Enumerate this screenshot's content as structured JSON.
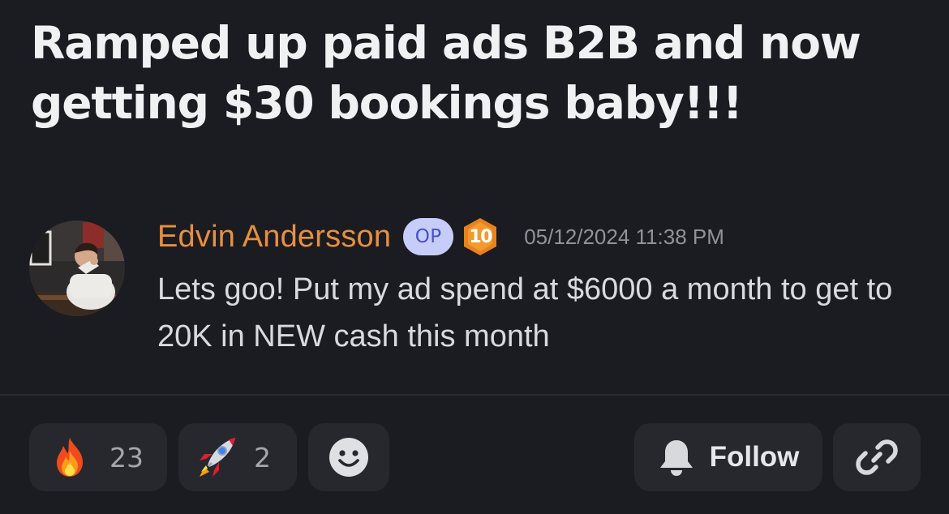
{
  "post": {
    "title": "Ramped up paid ads B2B and now getting $30 bookings baby!!!"
  },
  "message": {
    "author": "Edvin Andersson",
    "op_badge": "OP",
    "level": "10",
    "timestamp": "05/12/2024 11:38 PM",
    "text": "Lets goo! Put my ad spend at $6000 a month to get to 20K in NEW cash this month"
  },
  "reactions": [
    {
      "icon": "fire-emoji-icon",
      "count": "23"
    },
    {
      "icon": "rocket-emoji-icon",
      "count": "2"
    }
  ],
  "actions": {
    "add_reaction_icon": "smiley-icon",
    "follow_icon": "bell-icon",
    "follow_label": "Follow",
    "copy_link_icon": "link-icon"
  },
  "colors": {
    "background": "#1b1c21",
    "author_name": "#e98f3f",
    "op_badge_bg": "#c7cdf9",
    "op_badge_text": "#4651c9",
    "level_badge": "#e8821e",
    "pill_bg": "#27282e"
  }
}
